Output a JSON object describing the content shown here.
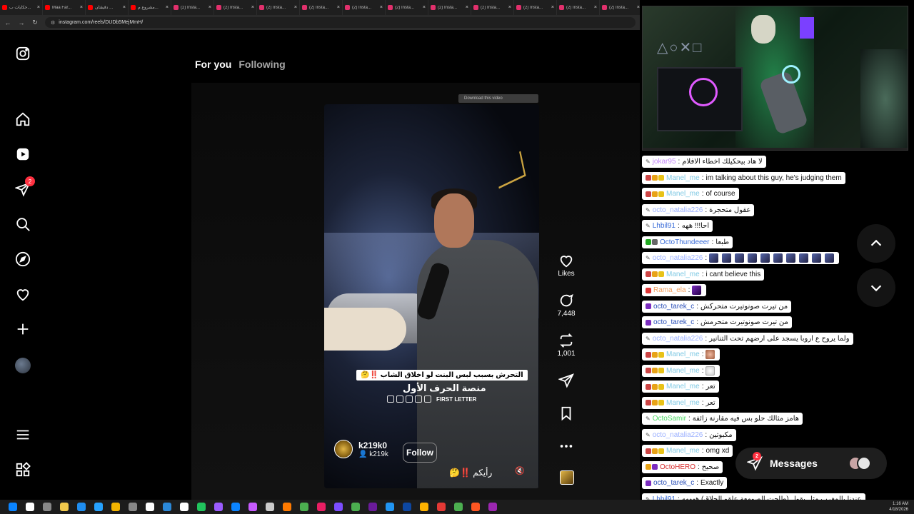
{
  "browser": {
    "tabs": [
      {
        "label": "حكايات ب...",
        "icon": "youtube"
      },
      {
        "label": "Maa Far...",
        "icon": "youtube"
      },
      {
        "label": "دقيقتان ...",
        "icon": "youtube"
      },
      {
        "label": "مشروع م...",
        "icon": "youtube"
      },
      {
        "label": "(2) Insta...",
        "icon": "instagram"
      },
      {
        "label": "(2) Insta...",
        "icon": "instagram"
      },
      {
        "label": "(2) Insta...",
        "icon": "instagram"
      },
      {
        "label": "(2) Insta...",
        "icon": "instagram"
      },
      {
        "label": "(2) Insta...",
        "icon": "instagram"
      },
      {
        "label": "(2) Insta...",
        "icon": "instagram"
      },
      {
        "label": "(2) Insta...",
        "icon": "instagram"
      },
      {
        "label": "(2) Insta...",
        "icon": "instagram"
      },
      {
        "label": "(2) Insta...",
        "icon": "instagram"
      },
      {
        "label": "(2) Insta...",
        "icon": "instagram"
      },
      {
        "label": "(2) Insta...",
        "icon": "instagram"
      }
    ],
    "url": "instagram.com/reels/DUDb5MejMmH/"
  },
  "instagram": {
    "notification_count": "2",
    "feed_tabs": {
      "active": "For you",
      "inactive": "Following"
    },
    "download_overlay": "Download this video",
    "reel": {
      "caption_overlay": "التحرش بسبب لبس البنت لو اخلاق الشاب ‼️🤔",
      "brand_title": "منصة الحرف الأول",
      "brand_sub": "FIRST LETTER",
      "author": "k219k0",
      "author_sub": "k219k",
      "follow_label": "Follow",
      "caption": "رأيكم ‼️🤔"
    },
    "actions": {
      "likes_label": "Likes",
      "comments_count": "7,448",
      "reposts_count": "1,001"
    }
  },
  "chat": {
    "messages": [
      {
        "user": "jokar95",
        "user_color": "#c58af9",
        "text": "لا هاد بيحكيلك اخطاء الافلام",
        "badges": []
      },
      {
        "user": "Manel_me",
        "user_color": "#7ec8e3",
        "text": "im talking about this guy, he's judging them",
        "badges": [
          "#c44",
          "#e8a317",
          "#e8c217"
        ]
      },
      {
        "user": "Manel_me",
        "user_color": "#7ec8e3",
        "text": "of course",
        "badges": [
          "#c44",
          "#e8a317",
          "#e8c217"
        ]
      },
      {
        "user": "octo_natalia226",
        "user_color": "#9bb0ff",
        "text": "عقول متحجرة",
        "badges": []
      },
      {
        "user": "Lhbil91",
        "user_color": "#3a6cd8",
        "text": "احا!!! ههه",
        "badges": []
      },
      {
        "user": "OctoThundeeer",
        "user_color": "#3a6cd8",
        "text": "طبعا",
        "badges": [
          "#2a2",
          "#666"
        ]
      },
      {
        "user": "octo_natalia226",
        "user_color": "#9bb0ff",
        "text": "",
        "emotes": 10,
        "badges": []
      },
      {
        "user": "Manel_me",
        "user_color": "#7ec8e3",
        "text": "i cant believe this",
        "badges": [
          "#c44",
          "#e8a317",
          "#e8c217"
        ]
      },
      {
        "user": "Rama_ela",
        "user_color": "#f4a261",
        "text": "",
        "emotes": 1,
        "emote_style": "purple",
        "badges": [
          "#d33"
        ]
      },
      {
        "user": "octo_tarek_c",
        "user_color": "#2a4fb8",
        "text": "من تيرت صونوتيرت متحركش",
        "badges": [
          "#7b2cbf"
        ]
      },
      {
        "user": "octo_tarek_c",
        "user_color": "#2a4fb8",
        "text": "من تيرت صونوتيرت متحرمش",
        "badges": [
          "#7b2cbf"
        ]
      },
      {
        "user": "octo_natalia226",
        "user_color": "#9bb0ff",
        "text": "ولما يروح ع اروبا يسجد على ارضهم تحت التنانير",
        "badges": []
      },
      {
        "user": "Manel_me",
        "user_color": "#7ec8e3",
        "text": "",
        "emotes": 1,
        "emote_style": "face",
        "badges": [
          "#c44",
          "#e8a317",
          "#e8c217"
        ]
      },
      {
        "user": "Manel_me",
        "user_color": "#7ec8e3",
        "text": "",
        "emotes": 1,
        "emote_style": "ghost",
        "badges": [
          "#c44",
          "#e8a317",
          "#e8c217"
        ]
      },
      {
        "user": "Manel_me",
        "user_color": "#7ec8e3",
        "text": "تعر",
        "badges": [
          "#c44",
          "#e8a317",
          "#e8c217"
        ]
      },
      {
        "user": "Manel_me",
        "user_color": "#7ec8e3",
        "text": "تعر",
        "badges": [
          "#c44",
          "#e8a317",
          "#e8c217"
        ]
      },
      {
        "user": "OctoSamir",
        "user_color": "#4cd964",
        "text": "هامز مثالك حلو بس فيه مقارنة زائفة",
        "badges": []
      },
      {
        "user": "octo_natalia226",
        "user_color": "#9bb0ff",
        "text": "مكبوتين",
        "badges": []
      },
      {
        "user": "Manel_me",
        "user_color": "#7ec8e3",
        "text": "omg xd",
        "badges": [
          "#c44",
          "#e8a317",
          "#e8c217"
        ]
      },
      {
        "user": "OctoHERO",
        "user_color": "#d62828",
        "text": "صحيح",
        "badges": [
          "#e8a317",
          "#7b2cbf"
        ]
      },
      {
        "user": "octo_tarek_c",
        "user_color": "#2a4fb8",
        "text": "Exactly",
        "badges": [
          "#7b2cbf"
        ]
      },
      {
        "user": "Lhbil91",
        "user_color": "#3a6cd8",
        "text": "عندنا بالمغرب مثل يقول (طاحت الصومعة علقو الحلاق) ههههه",
        "badges": []
      }
    ],
    "messages_label": "Messages",
    "messages_count": "2"
  },
  "taskbar": {
    "time": "1:16 AM",
    "date": "4/18/2026"
  }
}
